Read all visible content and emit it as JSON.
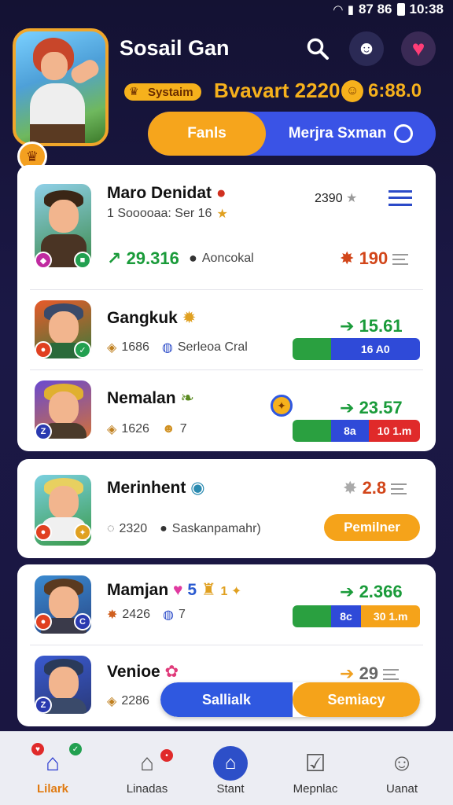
{
  "status_bar": {
    "signal_text": "87 86",
    "time": "10:38"
  },
  "header": {
    "title": "Sosail Gan",
    "coin_pill": "Systaim",
    "season_text": "Bvavart 2220",
    "gold_value": "6:88.0",
    "toggle": {
      "left_label": "Fanls",
      "right_label": "Merjra Sxman"
    }
  },
  "players": [
    {
      "name": "Maro Denidat",
      "sub_text": "1 Sooooaa: Ser 16",
      "top_stat": "2390",
      "stat": "29.316",
      "stat_label": "Aoncokal",
      "right_stat": "190"
    },
    {
      "name": "Gangkuk",
      "sub_left": "1686",
      "sub_text": "Serleoa Cral",
      "stat": "15.61",
      "bar_label": "16 A0"
    },
    {
      "name": "Nemalan",
      "sub_left": "1626",
      "sub_text": "7",
      "stat": "23.57",
      "bar_left": "8a",
      "bar_right": "10 1.m"
    },
    {
      "name": "Merinhent",
      "sub_left": "2320",
      "sub_text": "Saskanpamahr)",
      "stat": "2.8",
      "button_label": "Pemilner"
    },
    {
      "name": "Mamjan",
      "sub_left": "2426",
      "sub_text": "7",
      "stat": "2.366",
      "bar_left": "8c",
      "bar_right": "30 1.m"
    },
    {
      "name": "Venioe",
      "sub_left": "2286",
      "stat": "29",
      "action_left": "Sallialk",
      "action_right": "Semiacy"
    }
  ],
  "bottom_nav": [
    {
      "label": "Lilark",
      "icon": "home-icon",
      "active": true
    },
    {
      "label": "Linadas",
      "icon": "leagues-icon"
    },
    {
      "label": "Stant",
      "icon": "start-icon"
    },
    {
      "label": "Mepnlac",
      "icon": "clipboard-icon"
    },
    {
      "label": "Uanat",
      "icon": "user-icon"
    }
  ],
  "colors": {
    "accent_orange": "#f5a31a",
    "accent_blue": "#2f58e0",
    "stat_green": "#1a9b3a",
    "background": "#1b1846"
  }
}
